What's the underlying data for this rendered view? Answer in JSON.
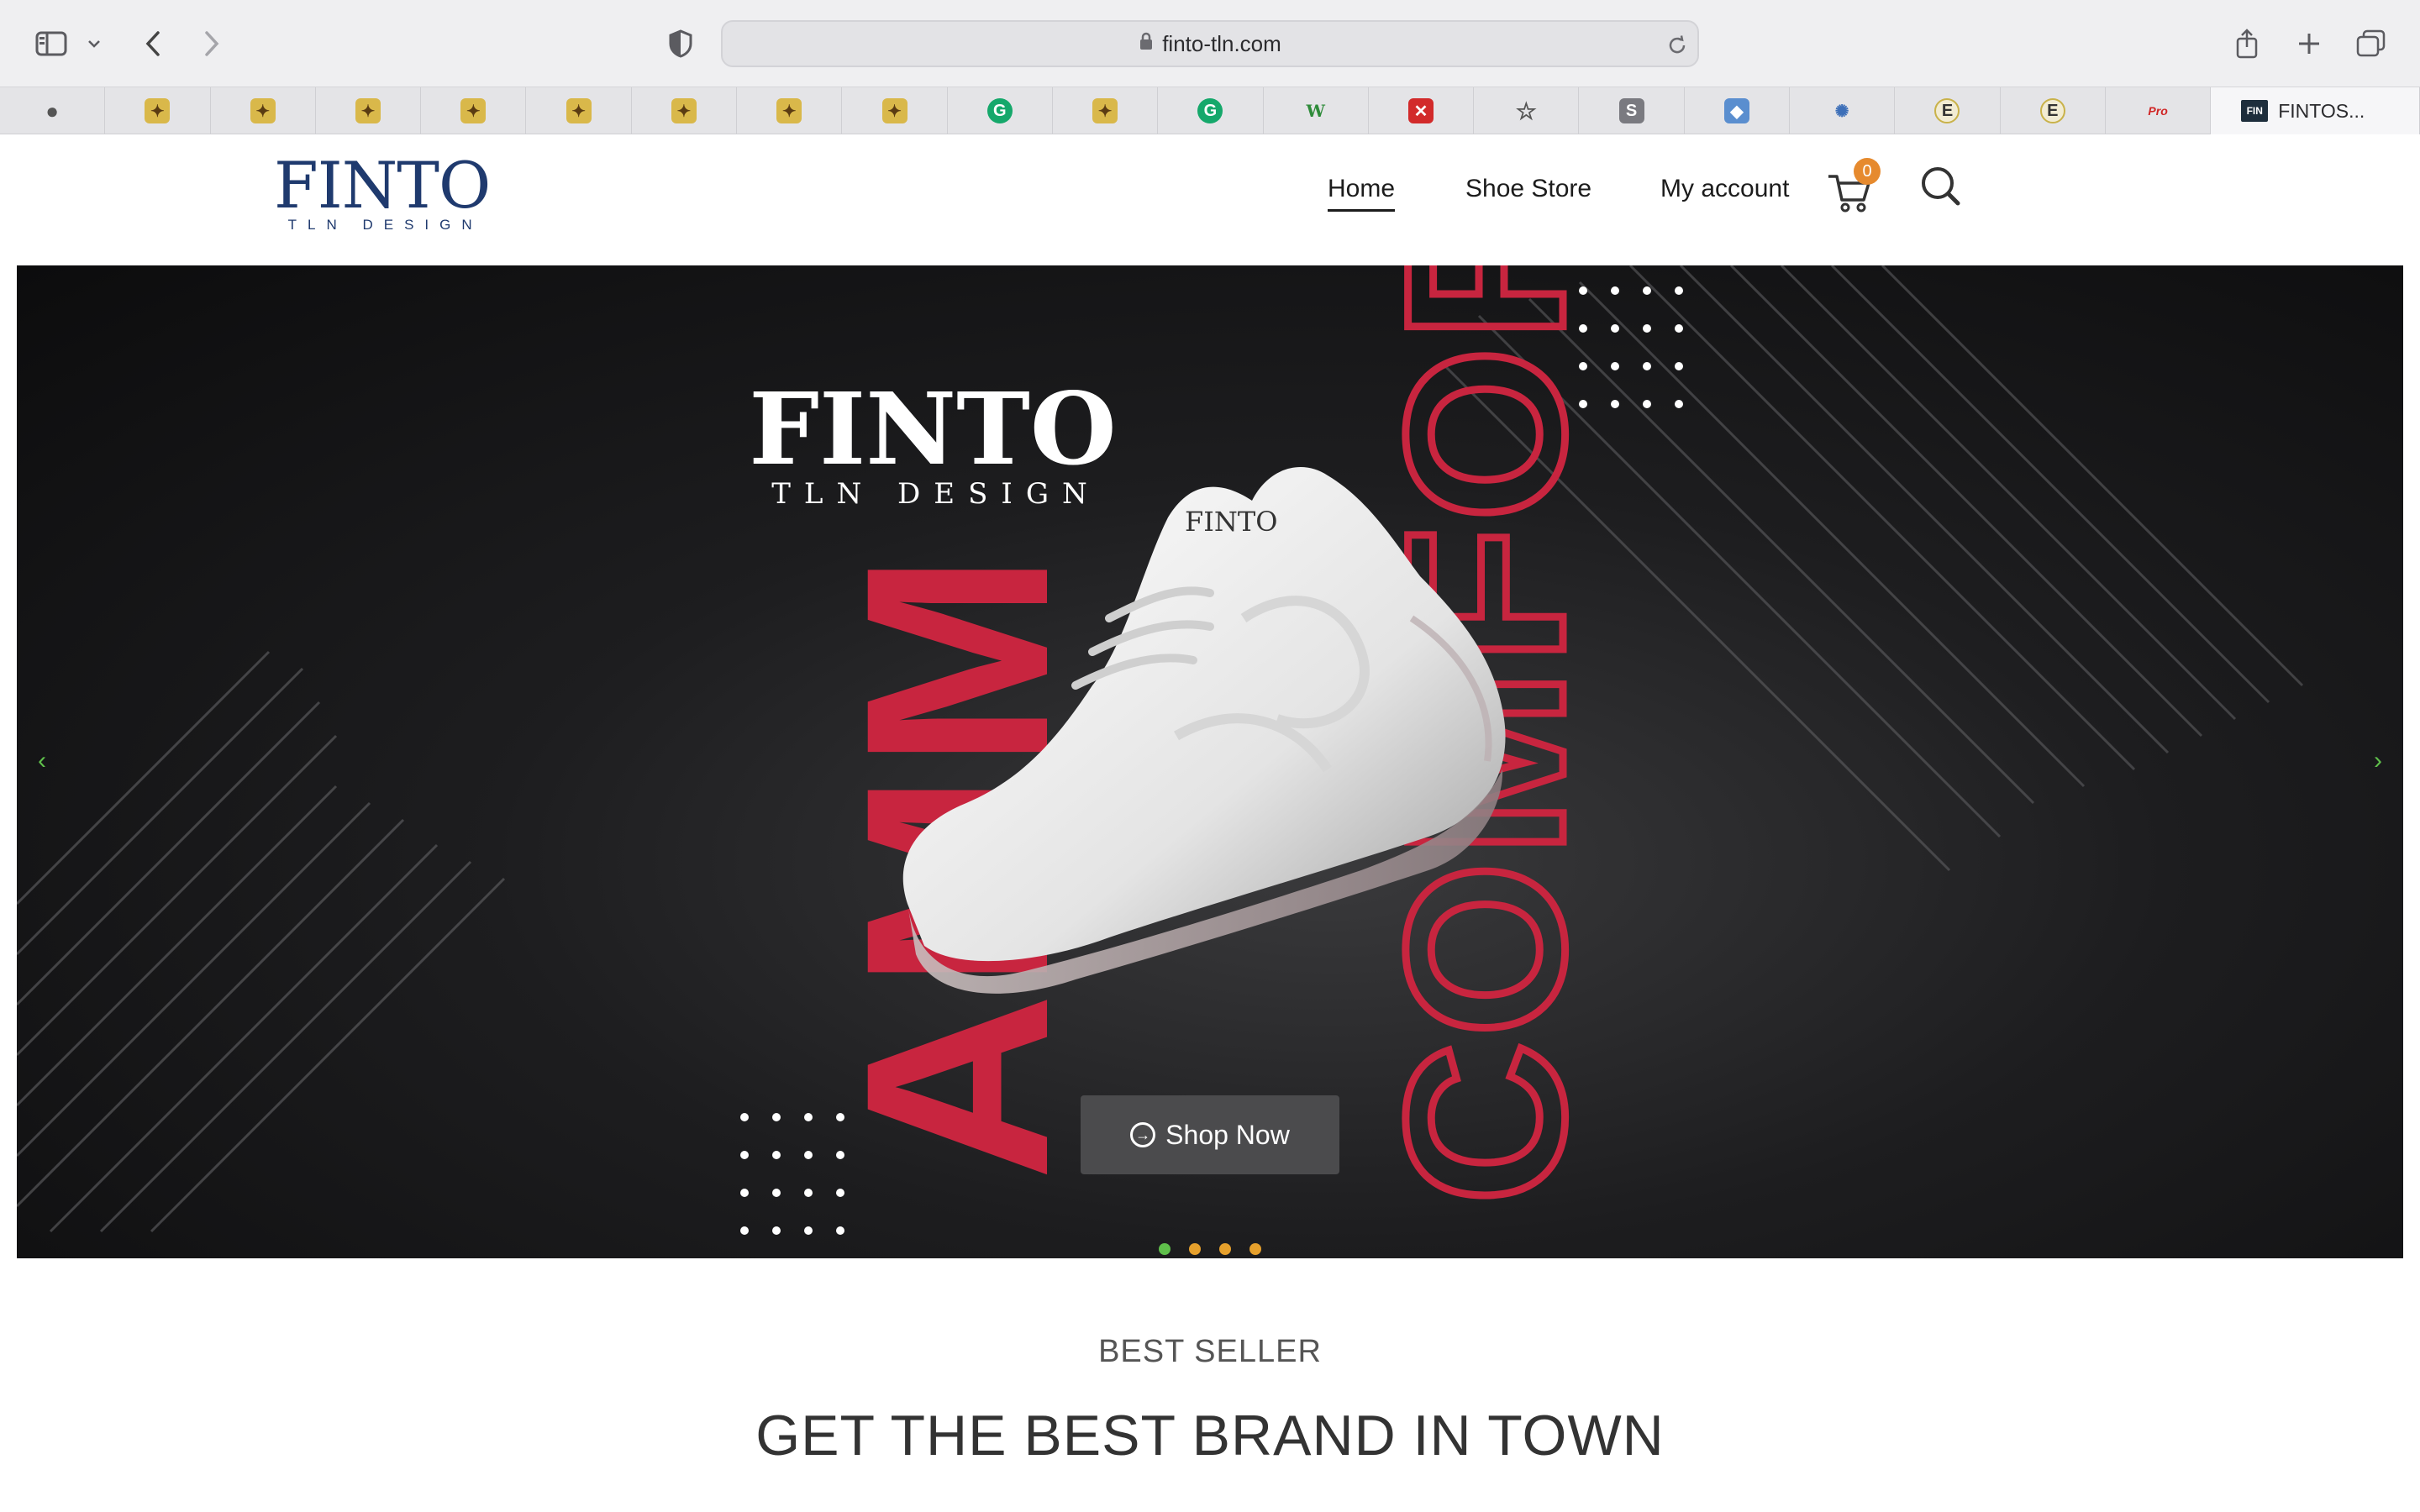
{
  "browser": {
    "url": "finto-tln.com",
    "active_tab_label": "FINTOS..."
  },
  "favorites": [
    {
      "icon": "apple-icon"
    },
    {
      "icon": "cat-icon"
    },
    {
      "icon": "cat-icon"
    },
    {
      "icon": "cat-icon"
    },
    {
      "icon": "cat-icon"
    },
    {
      "icon": "cat-icon"
    },
    {
      "icon": "cat-icon"
    },
    {
      "icon": "cat-icon"
    },
    {
      "icon": "cat-icon"
    },
    {
      "icon": "grammarly-icon"
    },
    {
      "icon": "cat-icon"
    },
    {
      "icon": "grammarly-icon"
    },
    {
      "icon": "w3-icon"
    },
    {
      "icon": "shield-x-icon"
    },
    {
      "icon": "star-icon"
    },
    {
      "icon": "s-icon"
    },
    {
      "icon": "cube-icon"
    },
    {
      "icon": "sparkle-icon"
    },
    {
      "icon": "e-icon"
    },
    {
      "icon": "e-icon"
    },
    {
      "icon": "pro-icon"
    }
  ],
  "header": {
    "logo_main": "FINTO",
    "logo_sub": "TLN DESIGN",
    "nav": [
      {
        "label": "Home",
        "active": true
      },
      {
        "label": "Shoe Store",
        "active": false
      },
      {
        "label": "My account",
        "active": false
      }
    ],
    "cart_count": "0"
  },
  "hero": {
    "brand_main": "FINTO",
    "brand_sub": "TLN DESIGN",
    "word_left": "AMM",
    "word_right": "COMFORT",
    "shoe_logo": "FINTO",
    "button_label": "Shop Now",
    "prev_arrow": "‹",
    "next_arrow": "›",
    "slides_count": 4,
    "active_slide": 1,
    "colors": {
      "accent": "#c8253f",
      "dot_active": "#5fbf4b",
      "dot_inactive": "#e6a02c"
    }
  },
  "sections": {
    "eyebrow": "BEST SELLER",
    "title": "GET THE BEST BRAND IN TOWN"
  }
}
